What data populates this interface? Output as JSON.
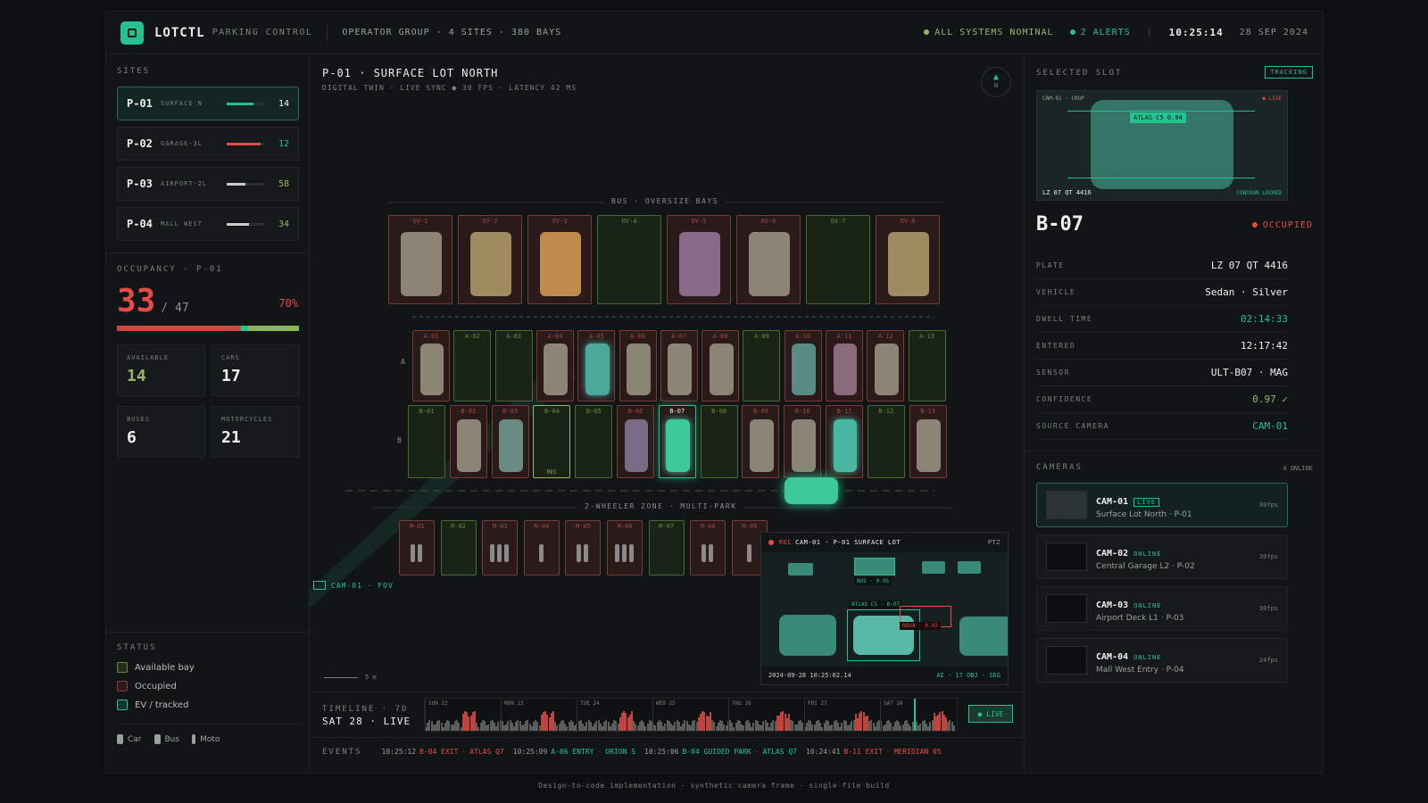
{
  "header": {
    "brand": "LOTCTL",
    "brand_sub": "PARKING CONTROL",
    "context": "OPERATOR GROUP · 4 SITES · 380 BAYS",
    "status": "ALL SYSTEMS NOMINAL",
    "alerts": "2 ALERTS",
    "sep": "|",
    "time": "10:25:14",
    "date": "28 SEP 2024"
  },
  "sites": {
    "label": "SITES",
    "items": [
      {
        "id": "P-01",
        "name": "SURFACE N",
        "value": "14",
        "fill": 0.72,
        "color": "#22c38e"
      },
      {
        "id": "P-02",
        "name": "GARAGE·3L",
        "value": "12",
        "fill": 0.9,
        "color": "#e64b45"
      },
      {
        "id": "P-03",
        "name": "AIRPORT·2L",
        "value": "58",
        "fill": 0.5,
        "color": "#c8ccc8"
      },
      {
        "id": "P-04",
        "name": "MALL WEST",
        "value": "34",
        "fill": 0.6,
        "color": "#c8ccc8"
      }
    ]
  },
  "occupancy": {
    "label": "OCCUPANCY · P-01",
    "occupied": "33",
    "total": "/ 47",
    "pct": "70%",
    "fill": 0.7
  },
  "stats": [
    {
      "label": "AVAILABLE",
      "value": "14"
    },
    {
      "label": "CARS",
      "value": "17"
    },
    {
      "label": "BUSES",
      "value": "6"
    },
    {
      "label": "MOTORCYCLES",
      "value": "21"
    }
  ],
  "status": {
    "label": "STATUS",
    "items": [
      {
        "label": "Available bay",
        "color": "#6a8a3a"
      },
      {
        "label": "Occupied",
        "color": "#8a3a36"
      },
      {
        "label": "EV / tracked",
        "color": "#22c38e"
      }
    ],
    "types": [
      "Car",
      "Bus",
      "Moto"
    ]
  },
  "main": {
    "title": "P-01 · SURFACE LOT NORTH",
    "subtitle": "DIGITAL TWIN · LIVE SYNC ● 30 FPS · LATENCY 42 MS",
    "compass": "N",
    "bus_zone": "BUS · OVERSIZE BAYS",
    "moto_zone": "2-WHEELER ZONE · MULTI-PARK",
    "row_a": "A",
    "row_b": "B",
    "fov": "CAM-01 · FOV",
    "scale": "5 m",
    "rec": "REC",
    "bus_bays": [
      {
        "id": "OV-1",
        "occ": true,
        "c": "#8c8474"
      },
      {
        "id": "OV-2",
        "occ": true,
        "c": "#a08a60"
      },
      {
        "id": "OV-3",
        "occ": true,
        "c": "#c08a4a"
      },
      {
        "id": "OV-4",
        "occ": false
      },
      {
        "id": "OV-5",
        "occ": true,
        "c": "#8a6a8a"
      },
      {
        "id": "OV-6",
        "occ": true,
        "c": "#8c8474"
      },
      {
        "id": "OV-7",
        "occ": false
      },
      {
        "id": "OV-8",
        "occ": true,
        "c": "#a08a60"
      }
    ],
    "a_bays": [
      {
        "id": "A-01",
        "occ": true,
        "c": "#8c8474"
      },
      {
        "id": "A-02",
        "occ": false
      },
      {
        "id": "A-03",
        "occ": false
      },
      {
        "id": "A-04",
        "occ": true,
        "c": "#8c8474"
      },
      {
        "id": "A-05",
        "occ": true,
        "c": "#4aa89a",
        "ev": true
      },
      {
        "id": "A-06",
        "occ": true,
        "c": "#8c8474"
      },
      {
        "id": "A-07",
        "occ": true,
        "c": "#8c8474"
      },
      {
        "id": "A-08",
        "occ": true,
        "c": "#8c8474"
      },
      {
        "id": "A-09",
        "occ": false
      },
      {
        "id": "A-10",
        "occ": true,
        "c": "#5a8a84"
      },
      {
        "id": "A-11",
        "occ": true,
        "c": "#8a6a7a"
      },
      {
        "id": "A-12",
        "occ": true,
        "c": "#8c8474"
      },
      {
        "id": "A-13",
        "occ": false
      }
    ],
    "b_bays": [
      {
        "id": "B-01",
        "occ": false
      },
      {
        "id": "B-02",
        "occ": true,
        "c": "#8c8474"
      },
      {
        "id": "B-03",
        "occ": true,
        "c": "#6a8a84"
      },
      {
        "id": "B-04",
        "occ": false,
        "rec": true
      },
      {
        "id": "B-05",
        "occ": false
      },
      {
        "id": "B-06",
        "occ": true,
        "c": "#7a6a84"
      },
      {
        "id": "B-07",
        "occ": true,
        "c": "#3ec99a",
        "sel": true
      },
      {
        "id": "B-08",
        "occ": false
      },
      {
        "id": "B-09",
        "occ": true,
        "c": "#8c8474"
      },
      {
        "id": "B-10",
        "occ": true,
        "c": "#8c8474"
      },
      {
        "id": "B-11",
        "occ": true,
        "c": "#4ab8a0",
        "ev": true
      },
      {
        "id": "B-12",
        "occ": false
      },
      {
        "id": "B-13",
        "occ": true,
        "c": "#8c8474"
      }
    ],
    "m_bays": [
      {
        "id": "M-01",
        "n": 2
      },
      {
        "id": "M-02",
        "n": 0
      },
      {
        "id": "M-03",
        "n": 3
      },
      {
        "id": "M-04",
        "n": 1
      },
      {
        "id": "M-05",
        "n": 2
      },
      {
        "id": "M-06",
        "n": 3
      },
      {
        "id": "M-07",
        "n": 0
      },
      {
        "id": "M-08",
        "n": 2
      },
      {
        "id": "M-09",
        "n": 1
      }
    ],
    "feed": {
      "rec": "REC",
      "title": "CAM-01 · P-01 SURFACE LOT",
      "ptz": "PTZ",
      "bus": "BUS · 0.95",
      "atlas": "ATLAS C5 · B-07",
      "nova": "NOVA · 0.93",
      "ts": "2024-09-28 10:25:02.14",
      "ai": "AI · 17 OBJ · SEG"
    }
  },
  "timeline": {
    "label": "TIMELINE · 7D",
    "now": "SAT 28 · LIVE",
    "days": [
      "SUN 22",
      "MON 23",
      "TUE 24",
      "WED 25",
      "THU 26",
      "FRI 27",
      "SAT 28"
    ],
    "live": "● LIVE",
    "events_label": "EVENTS",
    "events": [
      {
        "t": "10:25:12",
        "a": "B-04 EXIT",
        "b": "ATLAS Q7",
        "hot": true
      },
      {
        "t": "10:25:09",
        "a": "A-06 ENTRY",
        "b": "ORION S",
        "hot": false
      },
      {
        "t": "10:25:06",
        "a": "B-04 GUIDED PARK",
        "b": "ATLAS Q7",
        "hot": false
      },
      {
        "t": "10:24:41",
        "a": "B-11 EXIT",
        "b": "MERIDIAN 05",
        "hot": true
      }
    ]
  },
  "selected": {
    "label": "SELECTED SLOT",
    "tracking": "TRACKING",
    "crop_cam": "CAM-01 · CROP",
    "crop_live": "● LIVE",
    "crop_tag": "ATLAS C5 0.94",
    "crop_plate": "LZ 07 QT 4416",
    "contour": "CONTOUR LOCKED",
    "slot": "B-07",
    "state": "OCCUPIED",
    "fields": [
      {
        "k": "PLATE",
        "v": "LZ 07 QT 4416",
        "c": "#eef0ee"
      },
      {
        "k": "VEHICLE",
        "v": "Sedan · Silver",
        "c": "#eef0ee"
      },
      {
        "k": "DWELL TIME",
        "v": "02:14:33",
        "c": "#22c38e"
      },
      {
        "k": "ENTERED",
        "v": "12:17:42",
        "c": "#eef0ee"
      },
      {
        "k": "SENSOR",
        "v": "ULT-B07 · MAG",
        "c": "#eef0ee"
      },
      {
        "k": "CONFIDENCE",
        "v": "0.97 ✓",
        "c": "#9ab56a"
      },
      {
        "k": "SOURCE CAMERA",
        "v": "CAM-01",
        "c": "#22c38e"
      }
    ]
  },
  "cameras": {
    "label": "CAMERAS",
    "count": "4 ONLINE",
    "items": [
      {
        "id": "CAM-01",
        "st": "LIVE",
        "name": "Surface Lot North · P-01",
        "fps": "30fps"
      },
      {
        "id": "CAM-02",
        "st": "ONLINE",
        "name": "Central Garage L2 · P-02",
        "fps": "30fps"
      },
      {
        "id": "CAM-03",
        "st": "ONLINE",
        "name": "Airport Deck L1 · P-03",
        "fps": "30fps"
      },
      {
        "id": "CAM-04",
        "st": "ONLINE",
        "name": "Mall West Entry · P-04",
        "fps": "24fps"
      }
    ]
  },
  "footer": "Design-to-code implementation · synthetic camera frame · single-file build"
}
